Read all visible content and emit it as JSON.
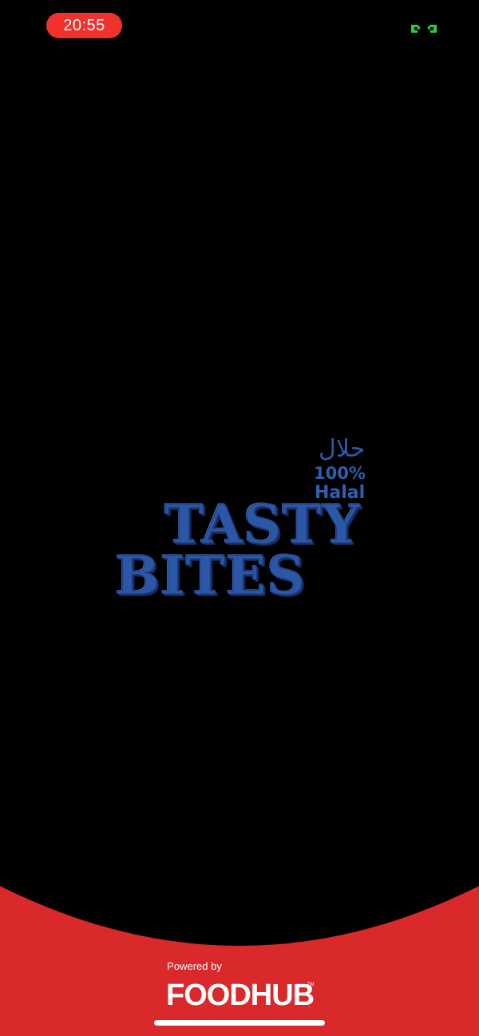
{
  "status_bar": {
    "time": "20:55",
    "time_pill_color": "#f0322d",
    "indicator_icon": "screen-mirroring-icon",
    "indicator_color": "#2ecc40"
  },
  "logo": {
    "arabic": "حلال",
    "percent": "100%",
    "halal": "Halal",
    "line1": "TASTY",
    "line2": "BITES",
    "color": "#2c56a6"
  },
  "footer": {
    "powered_by": "Powered by",
    "brand": "FOODHUB",
    "trademark": "TM",
    "background_color": "#d9292a"
  }
}
